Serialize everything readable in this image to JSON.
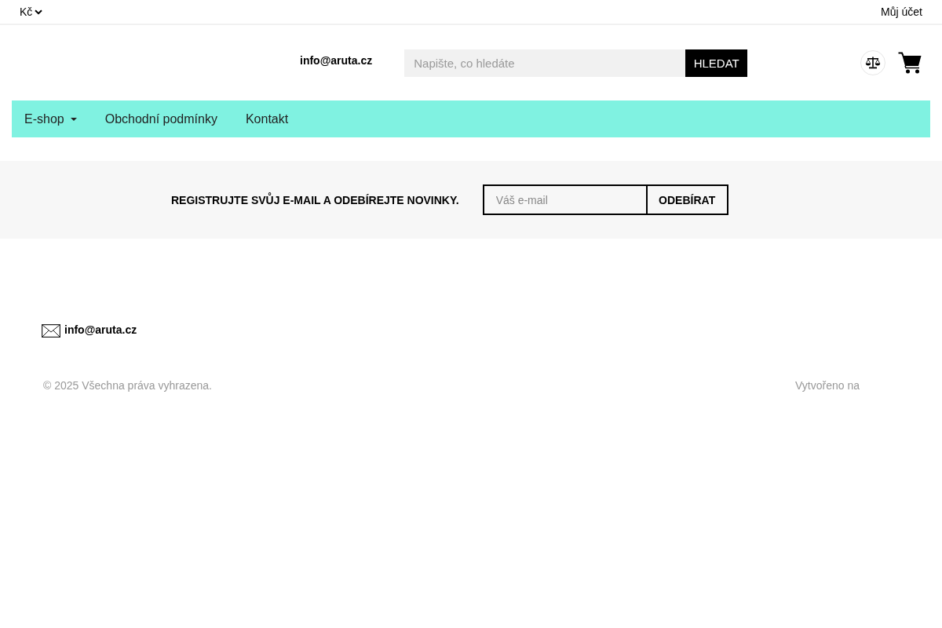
{
  "top_bar": {
    "currency": "Kč",
    "account_link": "Můj účet"
  },
  "header": {
    "email": "info@aruta.cz",
    "search": {
      "placeholder": "Napište, co hledáte",
      "button": "HLEDAT"
    }
  },
  "nav": {
    "items": [
      {
        "label": "E-shop",
        "has_dropdown": true
      },
      {
        "label": "Obchodní podmínky",
        "has_dropdown": false
      },
      {
        "label": "Kontakt",
        "has_dropdown": false
      }
    ]
  },
  "newsletter": {
    "text": "REGISTRUJTE SVŮJ E-MAIL A ODEBÍREJTE NOVINKY.",
    "email_field": {
      "placeholder": "Váš e-mail"
    },
    "button": "ODEBÍRAT"
  },
  "footer": {
    "email": "info@aruta.cz",
    "copyright": "© 2025 Všechna práva vyhrazena.",
    "credit": "Vytvořeno na"
  }
}
